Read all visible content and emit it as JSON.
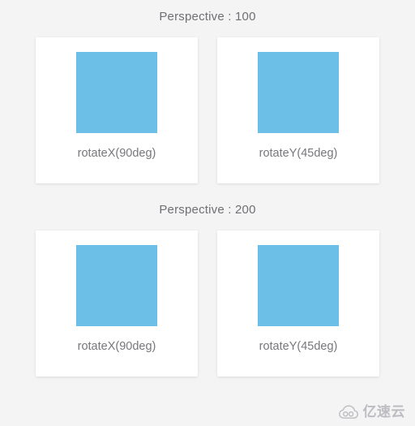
{
  "page": {
    "background_color": "#f4f4f5",
    "box_color": "#6cc0e7",
    "card_color": "#ffffff",
    "text_color": "#77777c"
  },
  "sections": [
    {
      "title": "Perspective : 100",
      "cards": [
        {
          "label": "rotateX(90deg)",
          "transform_name": "rotateX",
          "angle": "90deg"
        },
        {
          "label": "rotateY(45deg)",
          "transform_name": "rotateY",
          "angle": "45deg"
        }
      ]
    },
    {
      "title": "Perspective : 200",
      "cards": [
        {
          "label": "rotateX(90deg)",
          "transform_name": "rotateX",
          "angle": "90deg"
        },
        {
          "label": "rotateY(45deg)",
          "transform_name": "rotateY",
          "angle": "45deg"
        }
      ]
    }
  ],
  "watermark": {
    "icon": "cloud-icon",
    "text": "亿速云"
  }
}
